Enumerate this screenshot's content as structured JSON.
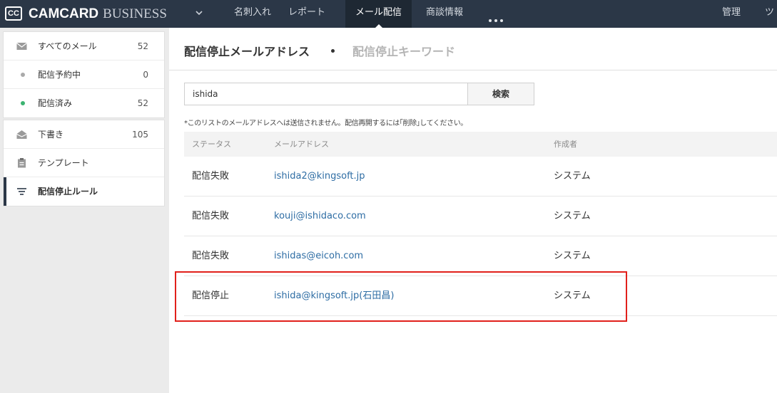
{
  "header": {
    "logo_mark": "CC",
    "brand_bold": "CAMCARD",
    "brand_light": "BUSINESS",
    "nav": [
      "名刺入れ",
      "レポート",
      "メール配信",
      "商談情報"
    ],
    "active_nav_index": 2,
    "right": [
      "管理",
      "ツ"
    ]
  },
  "sidebar": {
    "group1": [
      {
        "label": "すべてのメール",
        "count": "52",
        "icon": "envelope-icon"
      },
      {
        "label": "配信予約中",
        "count": "0",
        "dot_color": "#aaaaaa"
      },
      {
        "label": "配信済み",
        "count": "52",
        "dot_color": "#3cb371"
      }
    ],
    "group2": [
      {
        "label": "下書き",
        "count": "105",
        "icon": "open-envelope-icon"
      },
      {
        "label": "テンプレート",
        "icon": "clipboard-icon"
      },
      {
        "label": "配信停止ルール",
        "icon": "filter-lines-icon",
        "selected": true
      }
    ]
  },
  "main": {
    "tabs": {
      "active": "配信停止メールアドレス",
      "inactive": "配信停止キーワード"
    },
    "search": {
      "value": "ishida",
      "button": "検索"
    },
    "notice": "*このリストのメールアドレスへは送信されません。配信再開するには｢削除｣してください。",
    "table": {
      "headers": [
        "ステータス",
        "メールアドレス",
        "作成者"
      ],
      "rows": [
        {
          "status": "配信失敗",
          "email": "ishida2@kingsoft.jp",
          "creator": "システム"
        },
        {
          "status": "配信失敗",
          "email": "kouji@ishidaco.com",
          "creator": "システム"
        },
        {
          "status": "配信失敗",
          "email": "ishidas@eicoh.com",
          "creator": "システム"
        },
        {
          "status": "配信停止",
          "email": "ishida@kingsoft.jp(石田昌)",
          "creator": "システム"
        }
      ]
    }
  },
  "colors": {
    "topbar": "#2b3747",
    "link": "#2e6da4",
    "highlight": "#e1201b"
  }
}
